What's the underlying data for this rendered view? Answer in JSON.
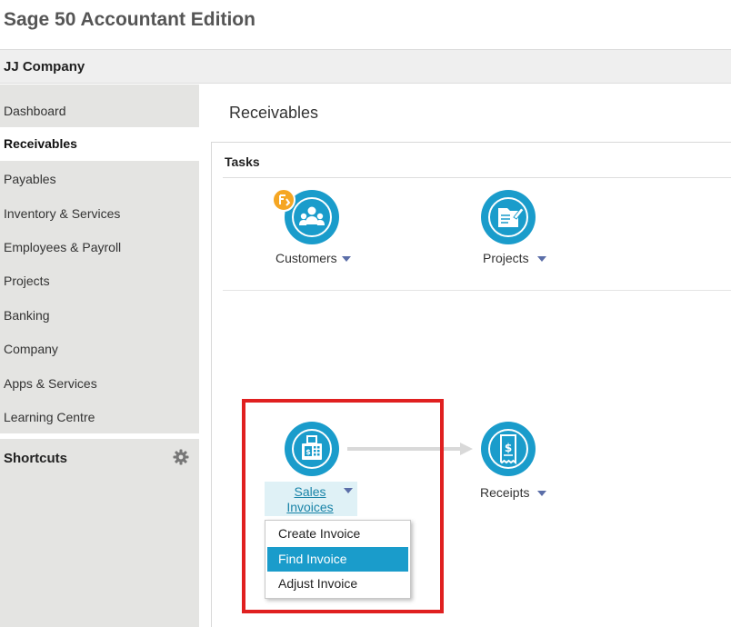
{
  "app": {
    "title": "Sage 50 Accountant Edition"
  },
  "company": {
    "name": "JJ Company"
  },
  "sidebar": {
    "items": [
      {
        "label": "Dashboard",
        "active": false
      },
      {
        "label": "Receivables",
        "active": true
      },
      {
        "label": "Payables",
        "active": false
      },
      {
        "label": "Inventory & Services",
        "active": false
      },
      {
        "label": "Employees & Payroll",
        "active": false
      },
      {
        "label": "Projects",
        "active": false
      },
      {
        "label": "Banking",
        "active": false
      },
      {
        "label": "Company",
        "active": false
      },
      {
        "label": "Apps & Services",
        "active": false
      },
      {
        "label": "Learning Centre",
        "active": false
      }
    ],
    "shortcuts_label": "Shortcuts"
  },
  "main": {
    "page_title": "Receivables",
    "tasks_label": "Tasks",
    "tasks": {
      "customers": {
        "label": "Customers",
        "icon": "customers-icon"
      },
      "projects": {
        "label": "Projects",
        "icon": "projects-icon"
      },
      "sales_invoices": {
        "label_line1": "Sales",
        "label_line2": "Invoices",
        "icon": "sales-invoices-icon"
      },
      "receipts": {
        "label": "Receipts",
        "icon": "receipts-icon"
      }
    },
    "invoice_menu": {
      "items": [
        {
          "label": "Create Invoice",
          "highlighted": false
        },
        {
          "label": "Find Invoice",
          "highlighted": true
        },
        {
          "label": "Adjust Invoice",
          "highlighted": false
        }
      ]
    }
  },
  "colors": {
    "accent": "#1a9ccb",
    "badge": "#f5a623",
    "highlight_frame": "#e02020",
    "link": "#1a84a8"
  }
}
